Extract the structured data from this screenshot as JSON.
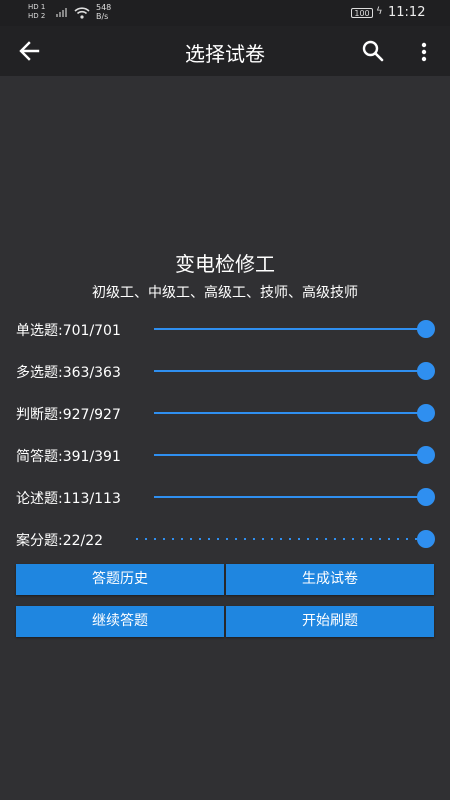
{
  "status_bar": {
    "sim1": "HD 1",
    "sim2": "HD 2",
    "net_speed_value": "548",
    "net_speed_unit": "B/s",
    "battery": "100",
    "time": "11:12"
  },
  "app_bar": {
    "title": "选择试卷",
    "back_icon": "arrow-left-icon",
    "search_icon": "search-icon",
    "more_icon": "more-vertical-icon"
  },
  "subject": {
    "title": "变电检修工",
    "levels": "初级工、中级工、高级工、技师、高级技师"
  },
  "question_types": [
    {
      "label": "单选题:701/701",
      "selected": 701,
      "total": 701
    },
    {
      "label": "多选题:363/363",
      "selected": 363,
      "total": 363
    },
    {
      "label": "判断题:927/927",
      "selected": 927,
      "total": 927
    },
    {
      "label": "简答题:391/391",
      "selected": 391,
      "total": 391
    },
    {
      "label": "论述题:113/113",
      "selected": 113,
      "total": 113
    },
    {
      "label": "案分题:22/22",
      "selected": 22,
      "total": 22
    }
  ],
  "buttons": {
    "history": "答题历史",
    "generate": "生成试卷",
    "continue": "继续答题",
    "start": "开始刷题"
  },
  "colors": {
    "accent": "#2f8ff0",
    "button": "#1f86e0",
    "background": "#303033",
    "app_bar": "#222224"
  }
}
